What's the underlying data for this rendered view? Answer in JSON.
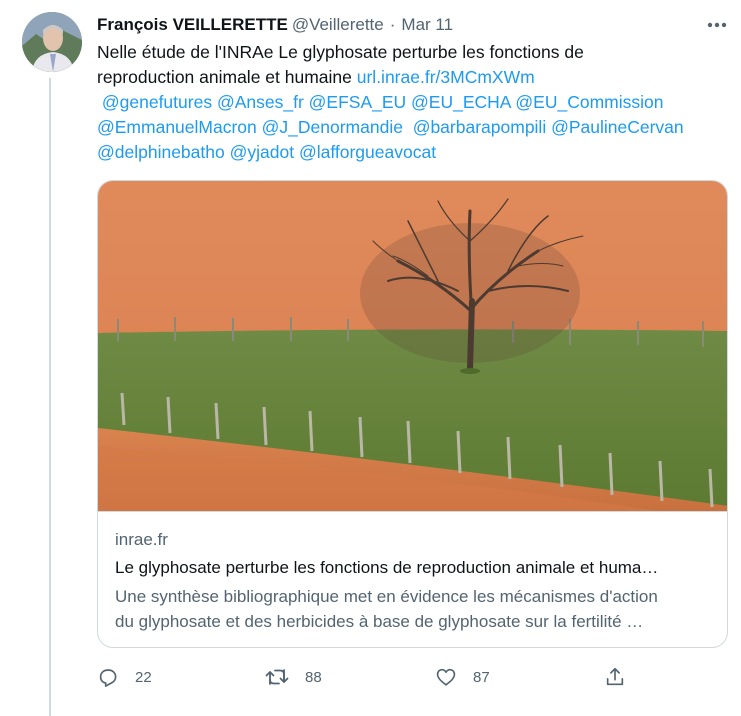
{
  "tweet": {
    "author_name": "François VEILLERETTE",
    "author_handle": "@Veillerette",
    "separator": "·",
    "date": "Mar 11",
    "text_line1": "Nelle étude de l'INRAe Le glyphosate perturbe les fonctions de",
    "text_line2": "reproduction animale et humaine ",
    "link": "url.inrae.fr/3MCmXWm",
    "mentions": [
      "@genefutures",
      "@Anses_fr",
      "@EFSA_EU",
      "@EU_ECHA",
      "@EU_Commission",
      "@EmmanuelMacron",
      "@J_Denormandie",
      "@barbarapompili",
      "@PaulineCervan",
      "@delphinebatho",
      "@yjadot",
      "@lafforgueavocat"
    ]
  },
  "card": {
    "domain": "inrae.fr",
    "title": "Le glyphosate perturbe les fonctions de reproduction animale et huma…",
    "description_line1": "Une synthèse bibliographique met en évidence les mécanismes d'action",
    "description_line2": "du glyphosate et des herbicides à base de glyphosate sur la fertilité …"
  },
  "actions": {
    "replies": "22",
    "retweets": "88",
    "likes": "87"
  },
  "icons": {
    "more": "more-horizontal-icon",
    "reply": "reply-bubble-icon",
    "retweet": "retweet-arrows-icon",
    "like": "heart-icon",
    "share": "share-upload-icon"
  },
  "colors": {
    "accent": "#1d9bf0",
    "secondary_text": "#536471",
    "border": "#cfd9de"
  }
}
